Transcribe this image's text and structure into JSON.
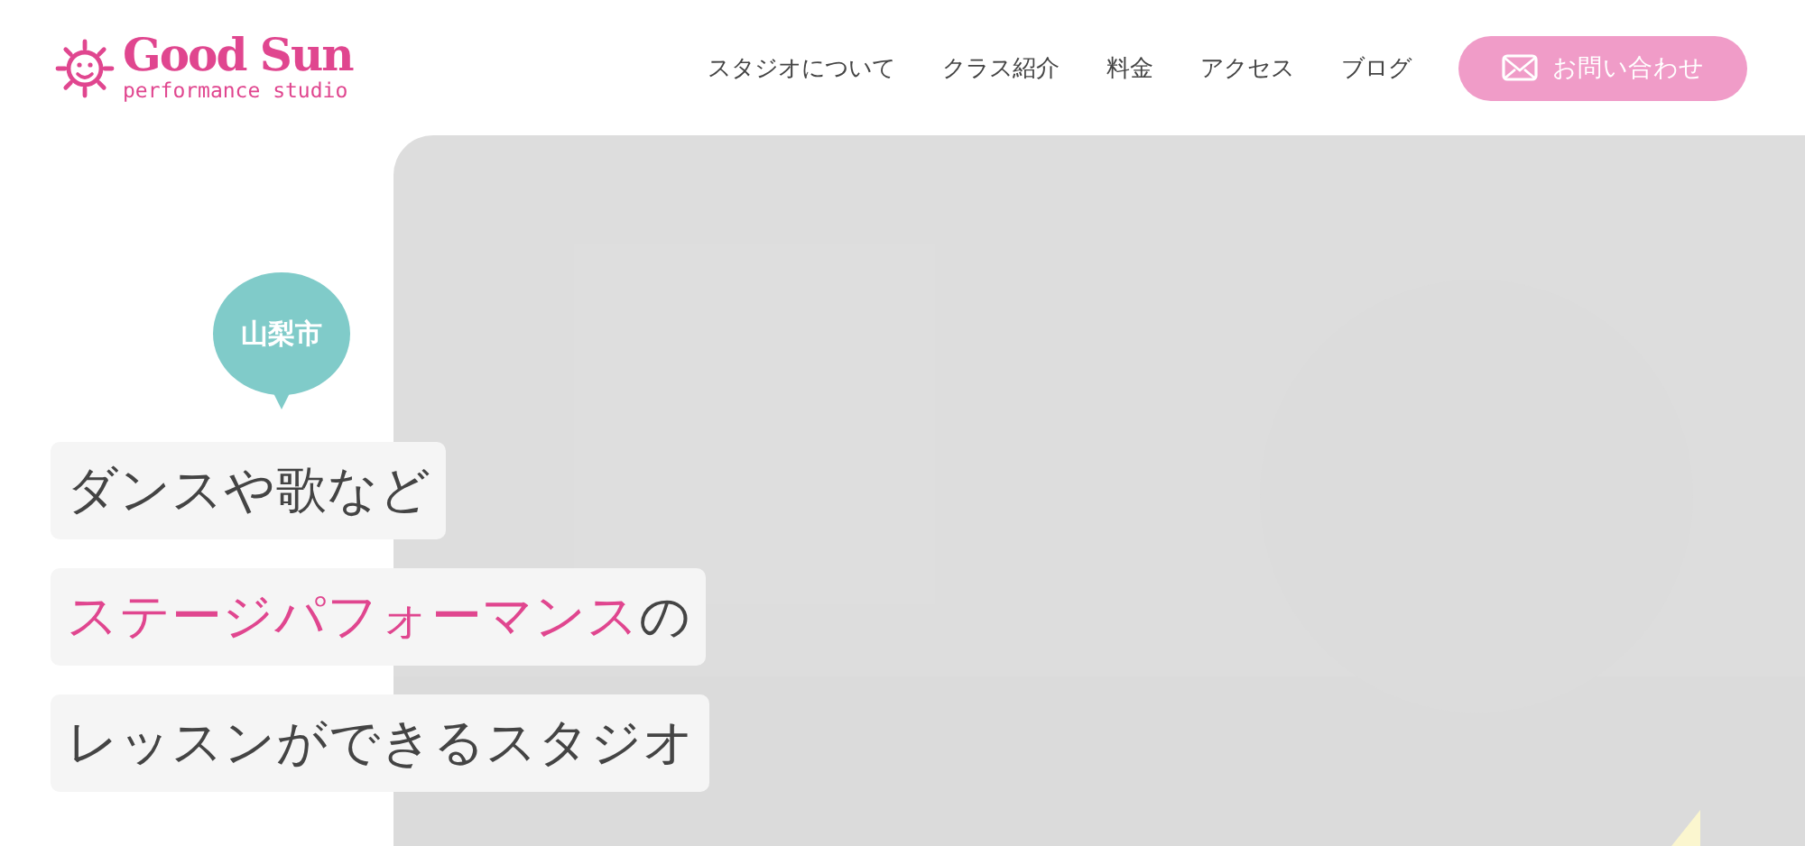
{
  "logo": {
    "title": "Good Sun",
    "subtitle": "performance studio"
  },
  "nav": {
    "items": [
      {
        "label": "スタジオについて"
      },
      {
        "label": "クラス紹介"
      },
      {
        "label": "料金"
      },
      {
        "label": "アクセス"
      },
      {
        "label": "ブログ"
      }
    ],
    "contact_button": "お問い合わせ"
  },
  "hero": {
    "badge": "山梨市",
    "image": {
      "kind": "picture"
    },
    "headline": [
      [
        {
          "text": "ダンスや歌など",
          "highlight": false
        }
      ],
      [
        {
          "text": "ステージパフォーマンス",
          "highlight": true
        },
        {
          "text": "の",
          "highlight": false
        }
      ],
      [
        {
          "text": "レッスンができるスタジオ",
          "highlight": false
        }
      ]
    ]
  }
}
